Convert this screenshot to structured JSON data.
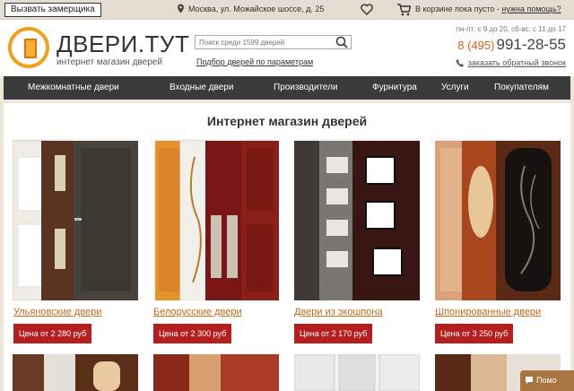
{
  "topbar": {
    "measurer_button": "Вызвать замерщика",
    "address": "Москва, ул. Можайское шоссе, д. 25",
    "cart_prefix": "В корзине пока пусто",
    "cart_sep": " - ",
    "cart_help": "нужна помощь?"
  },
  "header": {
    "logo_title": "ДВЕРИ.ТУТ",
    "logo_subtitle": "интернет магазин дверей",
    "search_placeholder": "Поиск среди 1599 дверей",
    "search_params_link": "Подбор дверей по параметрам",
    "hours": "пн-пт: с 9 до 20, сб-вс: с 11 до 17",
    "phone_code": "8 (495)",
    "phone_number": "991-28-55",
    "callback": "заказать обратный звонок"
  },
  "nav": {
    "items": [
      {
        "label": "Межкомнатные двери"
      },
      {
        "label": "Входные двери"
      },
      {
        "label": "Производители"
      },
      {
        "label": "Фурнитура"
      },
      {
        "label": "Услуги"
      },
      {
        "label": "Покупателям"
      }
    ]
  },
  "main": {
    "title": "Интернет магазин дверей",
    "cards": [
      {
        "name": "Ульяновские двери",
        "price": "Цена от 2 280 руб"
      },
      {
        "name": "Белорусские двери",
        "price": "Цена от 2 300 руб"
      },
      {
        "name": "Двери из экошпона",
        "price": "Цена от 2 170 руб"
      },
      {
        "name": "Шпонированные двери",
        "price": "Цена от 3 250 руб"
      }
    ]
  },
  "help_button": "Помо",
  "colors": {
    "accent": "#e05a1a",
    "price_bg": "#b51f1f",
    "link": "#c56a16",
    "nav_bg": "#3b3b3b"
  }
}
